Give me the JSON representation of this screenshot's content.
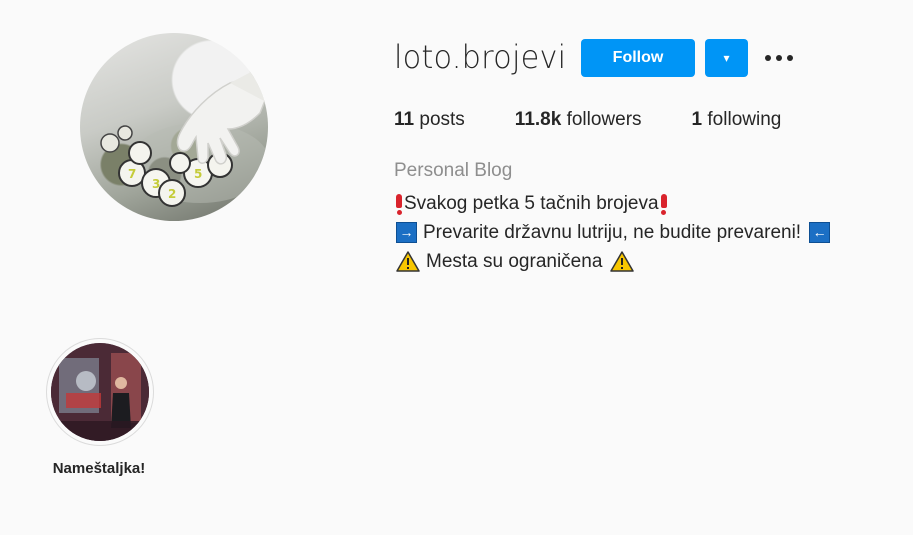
{
  "profile": {
    "username": "loto.brojevi",
    "follow_label": "Follow",
    "dropdown_icon": "▾",
    "more_icon": "more-options-icon",
    "stats": [
      {
        "count": "11",
        "label": " posts"
      },
      {
        "count": "11.8k",
        "label": " followers"
      },
      {
        "count": "1",
        "label": " following"
      }
    ],
    "category": "Personal Blog",
    "bio": {
      "line1": "Svakog petka 5 tačnih brojeva",
      "line2": "Prevarite državnu lutriju, ne budite prevareni!",
      "line3": "Mesta su ograničena"
    }
  },
  "highlights": [
    {
      "label": "Nameštaljka!"
    }
  ],
  "colors": {
    "accent": "#0095f6",
    "background": "#fafafa",
    "text": "#262626",
    "muted": "#8e8e8e"
  }
}
